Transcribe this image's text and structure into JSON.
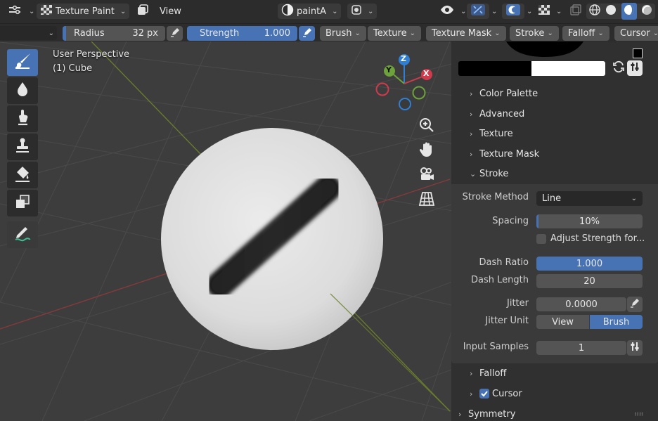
{
  "header": {
    "mode_label": "Texture Paint",
    "view_label": "View",
    "image_name": "paintA"
  },
  "tool_settings": {
    "radius_label": "Radius",
    "radius_value": "32 px",
    "strength_label": "Strength",
    "strength_value": "1.000",
    "menus": [
      "Brush",
      "Texture",
      "Texture Mask",
      "Stroke",
      "Falloff",
      "Cursor"
    ]
  },
  "viewport": {
    "perspective": "User Perspective",
    "object": "(1) Cube",
    "gizmo_axes": [
      "Z",
      "Y",
      "X"
    ]
  },
  "left_tools": [
    "draw-tool",
    "soften-tool",
    "smear-tool",
    "clone-tool",
    "fill-tool",
    "mask-tool",
    "annotate-tool"
  ],
  "panel": {
    "sections": [
      {
        "label": "Color Palette",
        "expanded": false
      },
      {
        "label": "Advanced",
        "expanded": false
      },
      {
        "label": "Texture",
        "expanded": false
      },
      {
        "label": "Texture Mask",
        "expanded": false
      },
      {
        "label": "Stroke",
        "expanded": true
      }
    ],
    "stroke": {
      "stroke_method_label": "Stroke Method",
      "stroke_method_value": "Line",
      "spacing_label": "Spacing",
      "spacing_value": "10%",
      "spacing_fraction": 0.1,
      "adjust_strength_label": "Adjust Strength for...",
      "dash_ratio_label": "Dash Ratio",
      "dash_ratio_value": "1.000",
      "dash_length_label": "Dash Length",
      "dash_length_value": "20",
      "jitter_label": "Jitter",
      "jitter_value": "0.0000",
      "jitter_unit_label": "Jitter Unit",
      "jitter_unit_options": [
        "View",
        "Brush"
      ],
      "jitter_unit_selected": "Brush",
      "input_samples_label": "Input Samples",
      "input_samples_value": "1"
    },
    "after_sections": [
      {
        "label": "Falloff",
        "expanded": false,
        "checkbox": false
      },
      {
        "label": "Cursor",
        "expanded": false,
        "checkbox": true,
        "checked": true
      },
      {
        "label": "Symmetry",
        "expanded": false,
        "checkbox": false
      }
    ]
  },
  "colors": {
    "accent": "#4772b3",
    "header_bg": "#2c2c2c",
    "panel_bg": "#303030",
    "viewport_bg": "#3d3d3d",
    "field_bg": "#545454"
  }
}
